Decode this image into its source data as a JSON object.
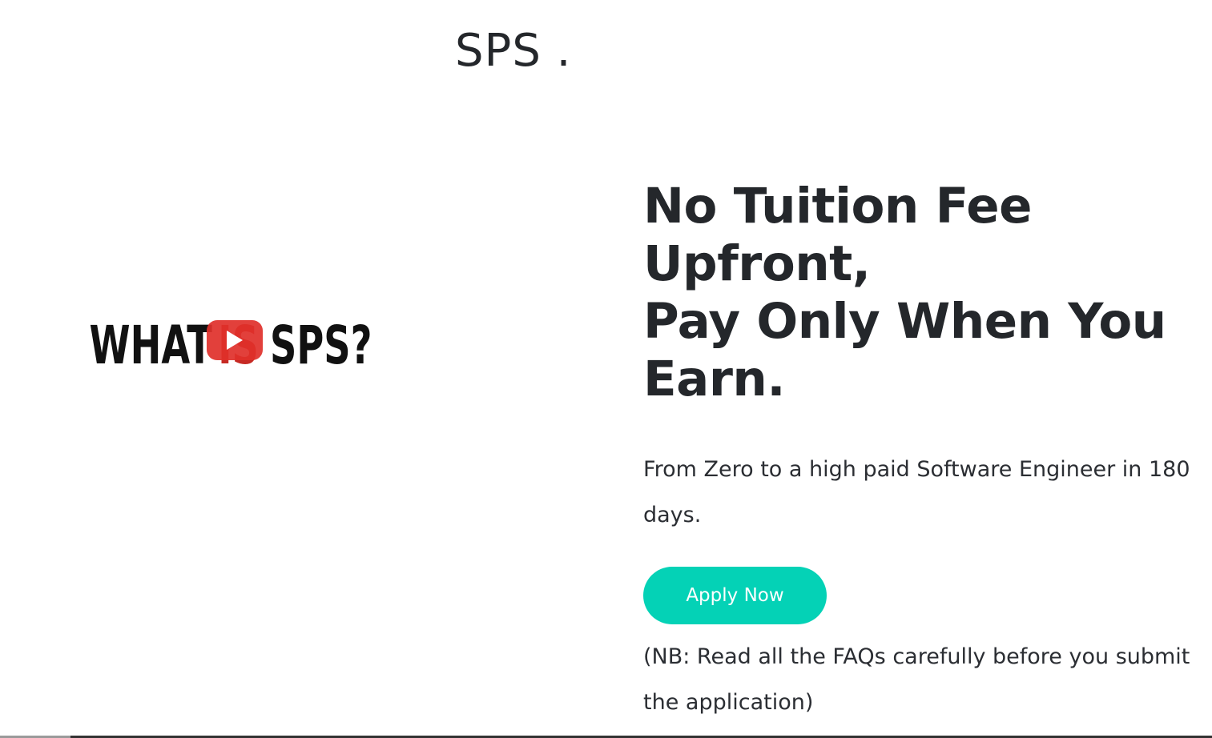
{
  "header": {
    "logo_text": "SPS ."
  },
  "video": {
    "thumbnail_text_left": "WHAT",
    "thumbnail_text_middle": "IS",
    "thumbnail_text_right": "SPS?",
    "play_icon": "youtube-play-icon",
    "play_button_color": "#e0302a"
  },
  "hero": {
    "headline_lines": [
      "No Tuition Fee",
      "Upfront,",
      "Pay Only When You",
      "Earn."
    ],
    "subtitle": "From Zero to a high paid Software Engineer in 180 days.",
    "apply_label": "Apply Now",
    "note": "(NB: Read all the FAQs carefully before you submit the application)"
  },
  "colors": {
    "accent": "#04d2b6",
    "text": "#24272b"
  }
}
